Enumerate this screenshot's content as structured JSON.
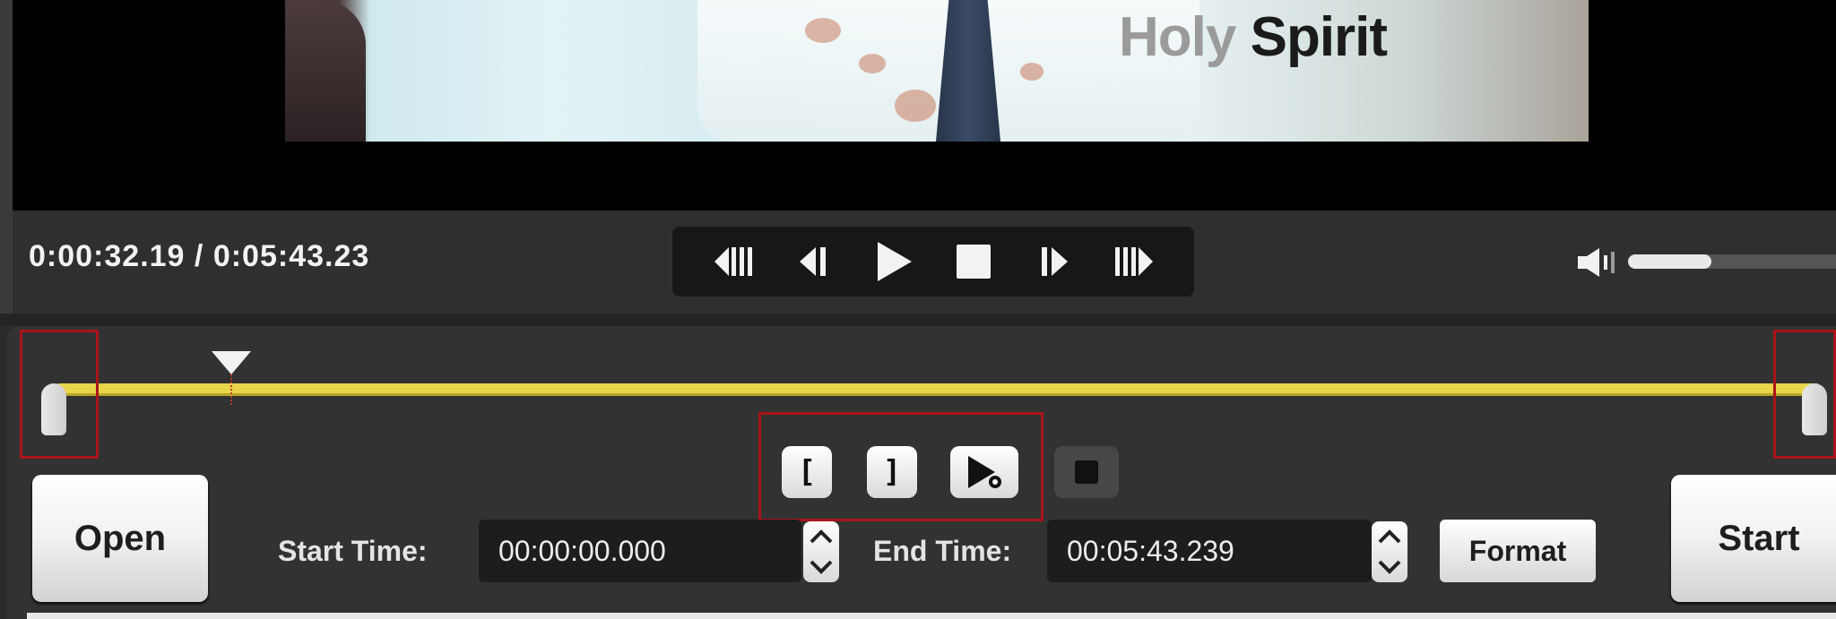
{
  "video": {
    "caption_word1": "Holy",
    "caption_word2": "Spirit"
  },
  "playback": {
    "current_time": "0:00:32.19",
    "separator": "/",
    "total_time": "0:05:43.23",
    "volume_level": 0.4,
    "transport_icons": [
      "skip-to-start-icon",
      "previous-frame-icon",
      "play-icon",
      "stop-icon",
      "next-frame-icon",
      "skip-to-end-icon"
    ]
  },
  "trim": {
    "track_color": "#e8d54a",
    "highlight_color": "#a8141a",
    "mark_start_glyph": "[",
    "mark_end_glyph": "]",
    "start_time_label": "Start Time:",
    "start_time_value": "00:00:00.000",
    "end_time_label": "End Time:",
    "end_time_value": "00:05:43.239",
    "format_label": "Format"
  },
  "actions": {
    "open_label": "Open",
    "start_label": "Start"
  }
}
